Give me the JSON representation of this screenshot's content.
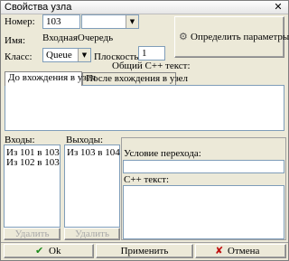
{
  "window": {
    "title": "Свойства узла",
    "close_glyph": "✕"
  },
  "form": {
    "number_label": "Номер:",
    "number_value": "103",
    "number_dropdown_value": "",
    "name_label": "Имя:",
    "name_value": "ВходнаяОчередь",
    "class_label": "Класс:",
    "class_value": "Queue",
    "plane_label": "Плоскость:",
    "plane_value": "1",
    "define_params_label": "Определить параметры...",
    "define_params_icon": "params-icon"
  },
  "cpp_common": {
    "label": "Общий С++ текст:",
    "tabs": [
      {
        "label": "До вхождения в узел",
        "active": true
      },
      {
        "label": "После вхождения в узел",
        "active": false
      }
    ]
  },
  "inputs": {
    "label": "Входы:",
    "items": [
      "Из 101 в 103",
      "Из 102 в 103"
    ],
    "delete_label": "Удалить"
  },
  "outputs": {
    "label": "Выходы:",
    "items": [
      "Из 103 в 104"
    ],
    "delete_label": "Удалить"
  },
  "transition": {
    "condition_label": "Условие перехода:",
    "cpp_label": "С++ текст:"
  },
  "footer": {
    "ok_label": "Ok",
    "ok_icon": "check-icon",
    "apply_label": "Применить",
    "cancel_label": "Отмена",
    "cancel_icon": "x-icon",
    "ok_icon_color": "#1a8a1a",
    "cancel_icon_color": "#c01010"
  }
}
